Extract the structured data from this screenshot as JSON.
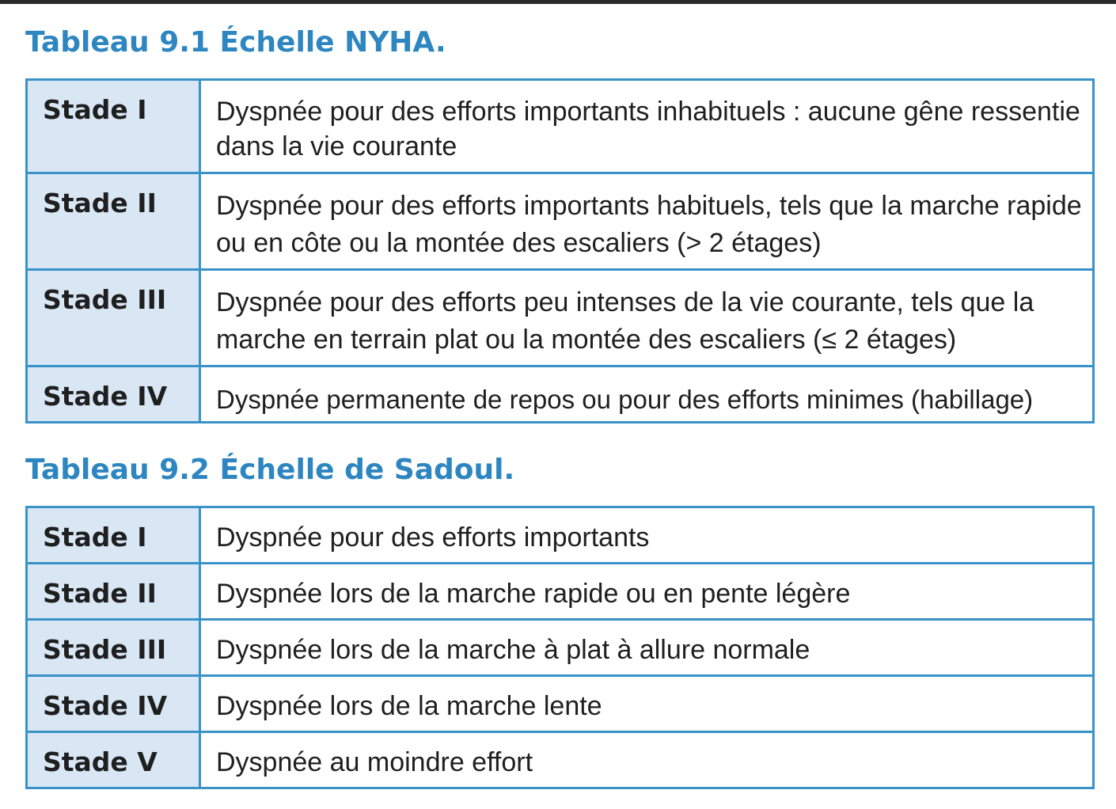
{
  "nyha": {
    "caption": "Tableau 9.1 Échelle NYHA.",
    "rows": [
      {
        "stage": "Stade I",
        "description": "Dyspnée pour des efforts importants inhabituels : aucune gêne ressentie dans la vie courante"
      },
      {
        "stage": "Stade II",
        "description": "Dyspnée pour des efforts importants habituels, tels que la marche rapide ou en côte ou la montée des escaliers (> 2 étages)"
      },
      {
        "stage": "Stade III",
        "description": "Dyspnée pour des efforts peu intenses de la vie courante, tels que la marche en terrain plat ou la montée des escaliers (≤ 2 étages)"
      },
      {
        "stage": "Stade IV",
        "description": "Dyspnée permanente de repos ou pour des efforts minimes (habillage)"
      }
    ]
  },
  "sadoul": {
    "caption": "Tableau 9.2 Échelle de Sadoul.",
    "rows": [
      {
        "stage": "Stade I",
        "description": "Dyspnée pour des efforts importants"
      },
      {
        "stage": "Stade II",
        "description": "Dyspnée lors de la marche rapide ou en pente légère"
      },
      {
        "stage": "Stade III",
        "description": "Dyspnée lors de la marche à plat à allure normale"
      },
      {
        "stage": "Stade IV",
        "description": "Dyspnée lors de la marche lente"
      },
      {
        "stage": "Stade V",
        "description": "Dyspnée au moindre effort"
      }
    ]
  },
  "colors": {
    "caption": "#2e86c1",
    "border": "#3a92c8",
    "stage_background": "#d9e7f5",
    "text": "#1f1f1f"
  }
}
